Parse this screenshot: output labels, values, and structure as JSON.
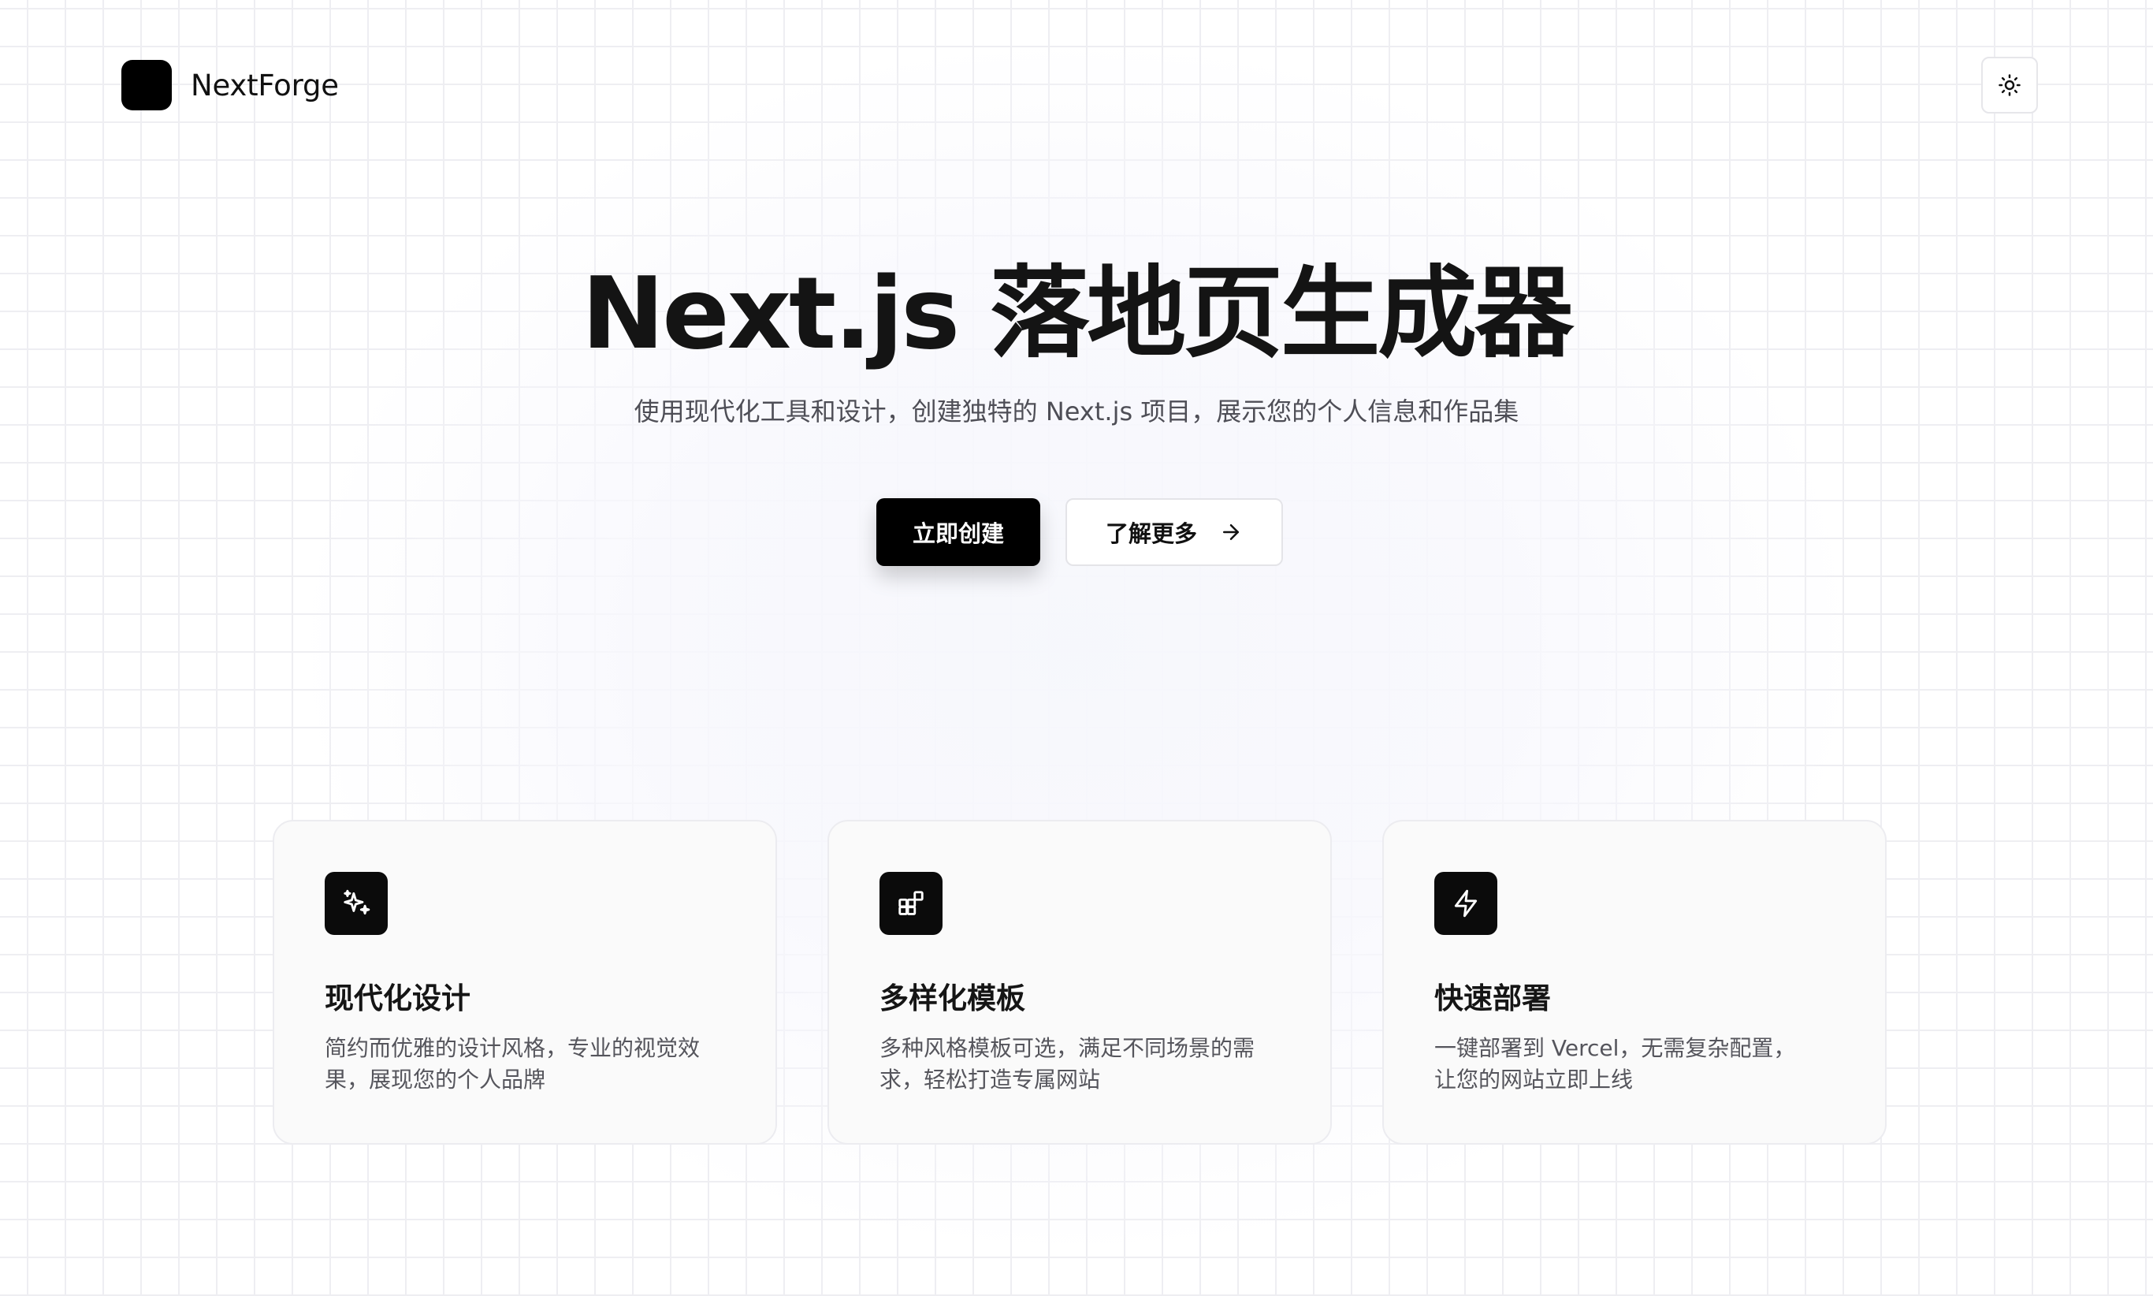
{
  "header": {
    "brand": "NextForge",
    "theme_toggle_icon": "sun-icon"
  },
  "hero": {
    "title": "Next.js 落地页生成器",
    "subtitle": "使用现代化工具和设计，创建独特的 Next.js 项目，展示您的个人信息和作品集",
    "primary_button": "立即创建",
    "secondary_button": "了解更多",
    "secondary_button_icon": "arrow-right-icon"
  },
  "features": [
    {
      "icon": "sparkles-icon",
      "title": "现代化设计",
      "description": "简约而优雅的设计风格，专业的视觉效果，展现您的个人品牌"
    },
    {
      "icon": "layout-blocks-icon",
      "title": "多样化模板",
      "description": "多种风格模板可选，满足不同场景的需求，轻松打造专属网站"
    },
    {
      "icon": "lightning-icon",
      "title": "快速部署",
      "description": "一键部署到 Vercel，无需复杂配置，让您的网站立即上线"
    }
  ],
  "colors": {
    "primary": "#000000",
    "background": "#ffffff",
    "grid": "#eeeef2",
    "muted_text": "#4e4e56"
  }
}
